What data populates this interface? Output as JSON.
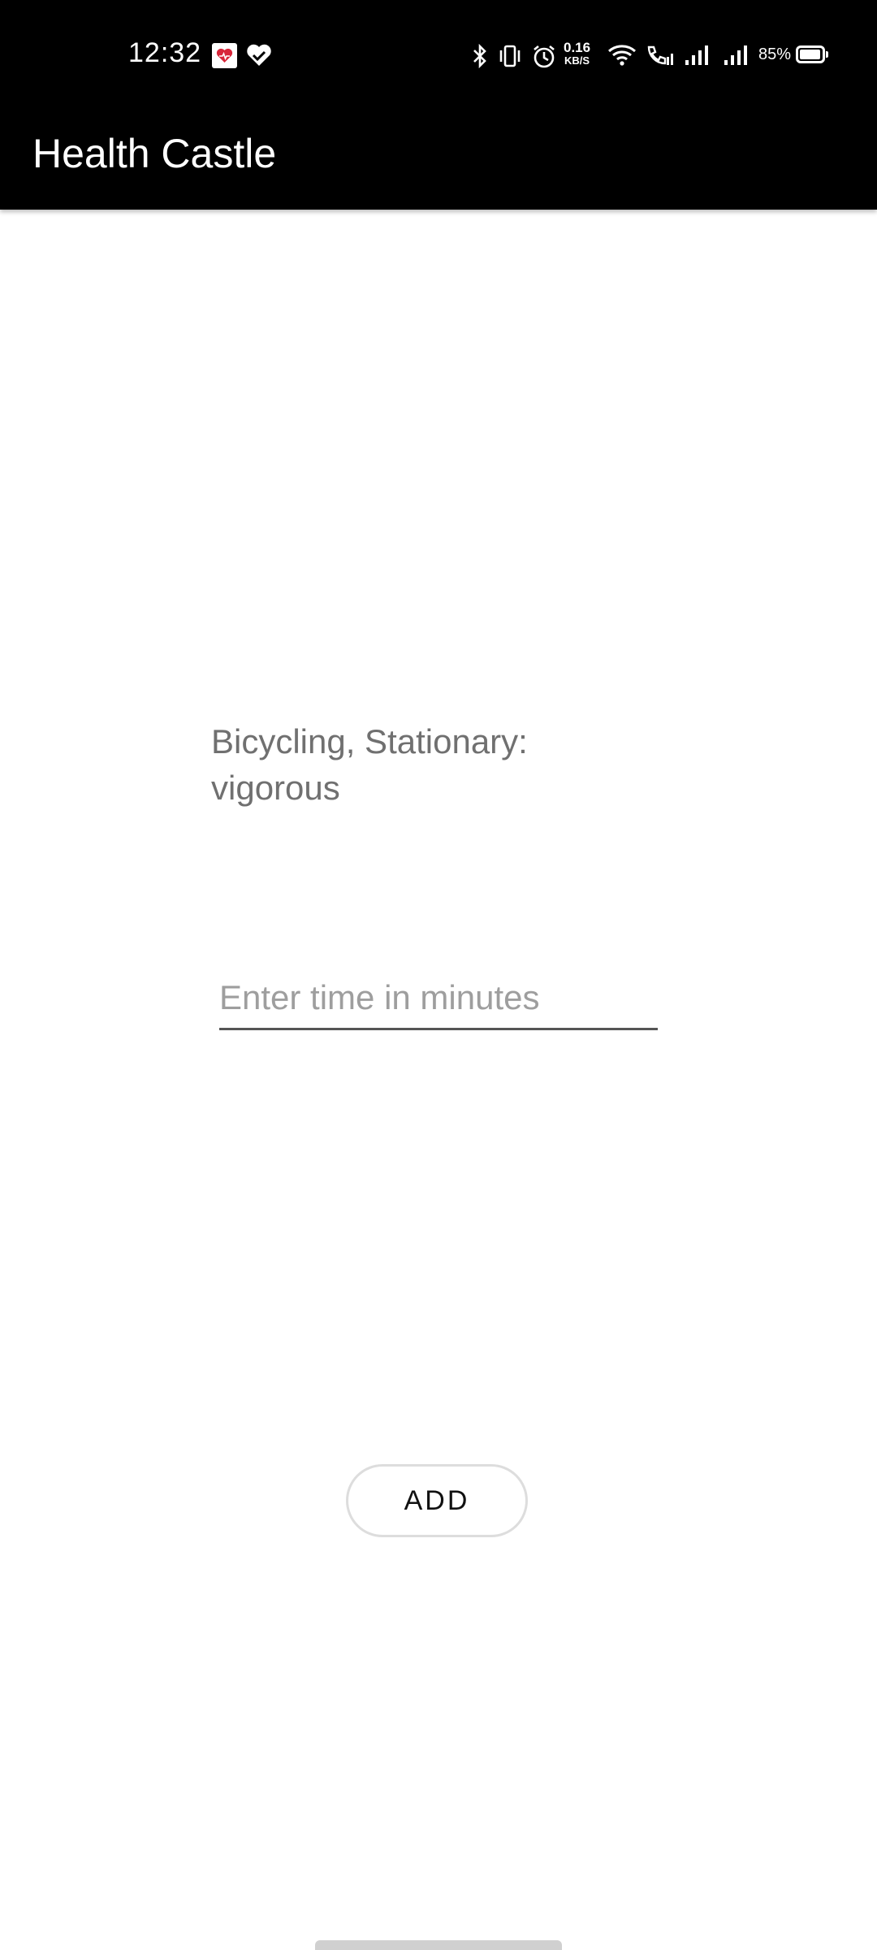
{
  "status_bar": {
    "time": "12:32",
    "net_speed_value": "0.16",
    "net_speed_unit": "KB/S",
    "battery_percent": "85%",
    "notification_icons": [
      "health-app-icon",
      "heart-check-icon"
    ],
    "system_icons": [
      "bluetooth-icon",
      "vibrate-icon",
      "alarm-icon",
      "wifi-icon",
      "wifi-calling-icon",
      "signal-icon",
      "signal-icon",
      "battery-icon"
    ]
  },
  "app_bar": {
    "title": "Health Castle"
  },
  "main": {
    "activity_name": "Bicycling, Stationary: vigorous",
    "time_input": {
      "value": "",
      "placeholder": "Enter time in minutes"
    },
    "add_button_label": "ADD"
  },
  "colors": {
    "app_bar_background": "#000000",
    "background": "#ffffff",
    "activity_text": "#707070",
    "placeholder_text": "#9e9e9e"
  }
}
